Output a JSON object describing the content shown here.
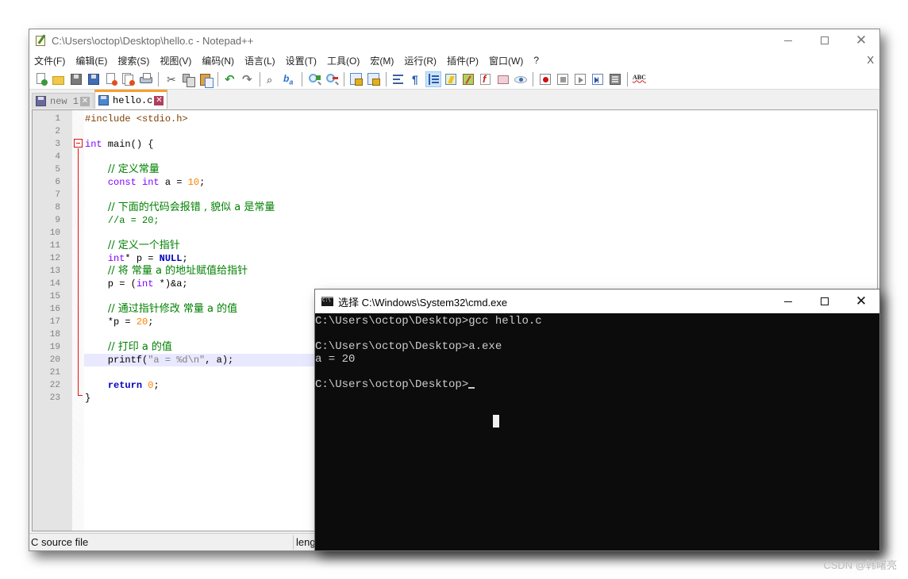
{
  "notepad": {
    "title": "C:\\Users\\octop\\Desktop\\hello.c - Notepad++",
    "window_controls": {
      "minimize": "minimize",
      "maximize": "maximize",
      "close": "close"
    },
    "menu": [
      "文件(F)",
      "编辑(E)",
      "搜索(S)",
      "视图(V)",
      "编码(N)",
      "语言(L)",
      "设置(T)",
      "工具(O)",
      "宏(M)",
      "运行(R)",
      "插件(P)",
      "窗口(W)",
      "?"
    ],
    "menu_close_doc": "X",
    "toolbar_icons": [
      "new-file-icon",
      "open-file-icon",
      "save-icon",
      "save-all-icon",
      "close-icon",
      "close-all-icon",
      "print-icon",
      "|",
      "cut-icon",
      "copy-icon",
      "paste-icon",
      "|",
      "undo-icon",
      "redo-icon",
      "|",
      "find-icon",
      "replace-icon",
      "|",
      "zoom-in-icon",
      "zoom-out-icon",
      "|",
      "sync-vertical-icon",
      "sync-horizontal-icon",
      "|",
      "word-wrap-icon",
      "show-all-chars-icon",
      "indent-guide-icon",
      "language-icon",
      "document-map-icon",
      "function-list-icon",
      "folder-workspace-icon",
      "monitoring-icon",
      "|",
      "record-macro-icon",
      "stop-macro-icon",
      "play-macro-icon",
      "run-macro-multiple-icon",
      "save-macro-icon",
      "|",
      "spell-check-icon"
    ],
    "spell_check_label": "ABC",
    "tabs": [
      {
        "label": "new 1",
        "active": false
      },
      {
        "label": "hello.c",
        "active": true
      }
    ],
    "editor": {
      "current_line": 20,
      "lines": [
        {
          "n": "1",
          "tokens": [
            [
              "pre",
              "#include <stdio.h>"
            ]
          ]
        },
        {
          "n": "2",
          "tokens": []
        },
        {
          "n": "3",
          "tokens": [
            [
              "kw",
              "int"
            ],
            [
              "id",
              " main() {"
            ]
          ]
        },
        {
          "n": "4",
          "tokens": []
        },
        {
          "n": "5",
          "tokens": [
            [
              "id",
              "    "
            ],
            [
              "cmt",
              "// 定义常量"
            ]
          ]
        },
        {
          "n": "6",
          "tokens": [
            [
              "id",
              "    "
            ],
            [
              "kw",
              "const"
            ],
            [
              "id",
              " "
            ],
            [
              "kw",
              "int"
            ],
            [
              "id",
              " a = "
            ],
            [
              "num",
              "10"
            ],
            [
              "id",
              ";"
            ]
          ]
        },
        {
          "n": "7",
          "tokens": []
        },
        {
          "n": "8",
          "tokens": [
            [
              "id",
              "    "
            ],
            [
              "cmt",
              "// 下面的代码会报错 , 貌似 a 是常量"
            ]
          ]
        },
        {
          "n": "9",
          "tokens": [
            [
              "id",
              "    "
            ],
            [
              "cmt",
              "//a = 20;"
            ]
          ]
        },
        {
          "n": "10",
          "tokens": []
        },
        {
          "n": "11",
          "tokens": [
            [
              "id",
              "    "
            ],
            [
              "cmt",
              "// 定义一个指针"
            ]
          ]
        },
        {
          "n": "12",
          "tokens": [
            [
              "id",
              "    "
            ],
            [
              "kw",
              "int"
            ],
            [
              "id",
              "* p = "
            ],
            [
              "kw2",
              "NULL"
            ],
            [
              "id",
              ";"
            ]
          ]
        },
        {
          "n": "13",
          "tokens": [
            [
              "id",
              "    "
            ],
            [
              "cmt",
              "// 将 常量 a 的地址赋值给指针"
            ]
          ]
        },
        {
          "n": "14",
          "tokens": [
            [
              "id",
              "    p = ("
            ],
            [
              "kw",
              "int"
            ],
            [
              "id",
              " *)&a;"
            ]
          ]
        },
        {
          "n": "15",
          "tokens": []
        },
        {
          "n": "16",
          "tokens": [
            [
              "id",
              "    "
            ],
            [
              "cmt",
              "// 通过指针修改 常量 a 的值"
            ]
          ]
        },
        {
          "n": "17",
          "tokens": [
            [
              "id",
              "    *p = "
            ],
            [
              "num",
              "20"
            ],
            [
              "id",
              ";"
            ]
          ]
        },
        {
          "n": "18",
          "tokens": []
        },
        {
          "n": "19",
          "tokens": [
            [
              "id",
              "    "
            ],
            [
              "cmt",
              "// 打印 a 的值"
            ]
          ]
        },
        {
          "n": "20",
          "tokens": [
            [
              "id",
              "    printf("
            ],
            [
              "str",
              "\"a = %d\\n\""
            ],
            [
              "id",
              ", a);"
            ]
          ]
        },
        {
          "n": "21",
          "tokens": []
        },
        {
          "n": "22",
          "tokens": [
            [
              "id",
              "    "
            ],
            [
              "kw2",
              "return"
            ],
            [
              "id",
              " "
            ],
            [
              "num",
              "0"
            ],
            [
              "id",
              ";"
            ]
          ]
        },
        {
          "n": "23",
          "tokens": [
            [
              "id",
              "}"
            ]
          ]
        }
      ]
    },
    "status": {
      "file_type": "C source file",
      "length_partial": "leng"
    }
  },
  "cmd": {
    "title": "选择 C:\\Windows\\System32\\cmd.exe",
    "window_controls": {
      "minimize": "minimize",
      "maximize": "maximize",
      "close": "close"
    },
    "lines": [
      "C:\\Users\\octop\\Desktop>gcc hello.c",
      "",
      "C:\\Users\\octop\\Desktop>a.exe",
      "a = 20",
      "",
      "C:\\Users\\octop\\Desktop>"
    ]
  },
  "watermark": "CSDN @韩曙亮"
}
